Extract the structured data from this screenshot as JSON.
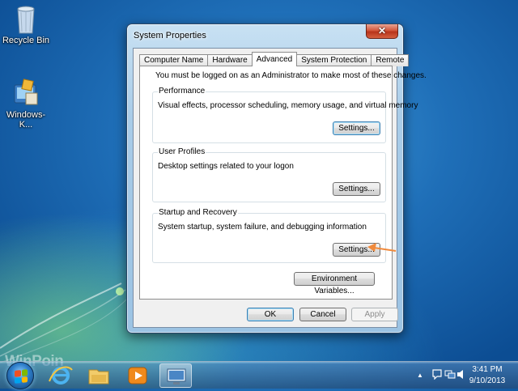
{
  "desktop": {
    "icons": [
      {
        "label": "Recycle Bin",
        "icon": "recycle-bin-icon"
      },
      {
        "label": "Windows-K...",
        "icon": "installer-icon"
      }
    ],
    "watermark": "WinPoin"
  },
  "window": {
    "title": "System Properties",
    "close_label": "✕",
    "tabs": [
      {
        "label": "Computer Name",
        "active": false
      },
      {
        "label": "Hardware",
        "active": false
      },
      {
        "label": "Advanced",
        "active": true
      },
      {
        "label": "System Protection",
        "active": false
      },
      {
        "label": "Remote",
        "active": false
      }
    ],
    "notice": "You must be logged on as an Administrator to make most of these changes.",
    "groups": {
      "performance": {
        "title": "Performance",
        "description": "Visual effects, processor scheduling, memory usage, and virtual memory",
        "button": "Settings..."
      },
      "user_profiles": {
        "title": "User Profiles",
        "description": "Desktop settings related to your logon",
        "button": "Settings..."
      },
      "startup_recovery": {
        "title": "Startup and Recovery",
        "description": "System startup, system failure, and debugging information",
        "button": "Settings..."
      }
    },
    "env_button": "Environment Variables...",
    "ok": "OK",
    "cancel": "Cancel",
    "apply": "Apply"
  },
  "annotation": {
    "type": "arrow",
    "color": "#f08a3c",
    "points_to": "startup-recovery-settings-button"
  },
  "taskbar": {
    "pinned": [
      {
        "icon": "internet-explorer-icon"
      },
      {
        "icon": "windows-explorer-icon"
      },
      {
        "icon": "media-player-icon"
      },
      {
        "icon": "system-properties-icon",
        "active": true
      }
    ],
    "tray": {
      "show_hidden": "▲"
    },
    "clock": {
      "time": "3:41 PM",
      "date": "9/10/2013"
    }
  },
  "colors": {
    "accent": "#3c7fb1",
    "arrow": "#f08a3c",
    "close": "#c8452a"
  }
}
